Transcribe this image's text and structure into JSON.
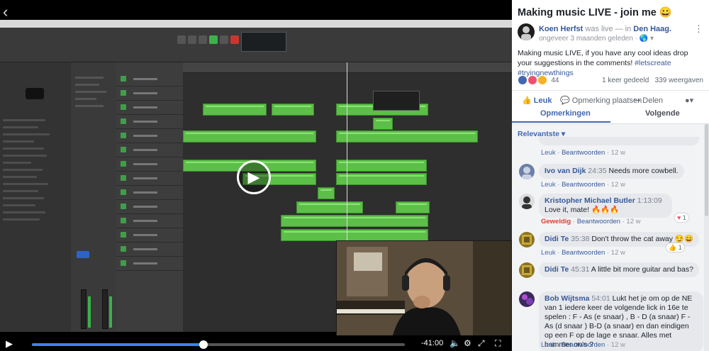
{
  "player": {
    "back_glyph": "‹",
    "time_remaining": "-41:00",
    "progress": 0.46,
    "play_glyph": "▶",
    "controls": [
      "play-icon",
      "volume-icon",
      "settings-icon",
      "fullscreen-icon",
      "expand-icon"
    ]
  },
  "post": {
    "title": "Making music LIVE - join me 😀",
    "author": "Koen Herfst",
    "was_live": "was live —",
    "in_word": "in",
    "location": "Den Haag.",
    "time": "ongeveer 3 maanden geleden · 🌎 ▾",
    "description": "Making music LIVE, if you have any cool ideas drop your suggestions in the comments!",
    "hashtags": "#letscreate #tryingnewthings",
    "reaction_count": "44",
    "shares": "1 keer gedeeld",
    "views": "339 weergaven",
    "actions": {
      "like": "Leuk",
      "comment": "Opmerking plaatsen",
      "share": "Delen"
    },
    "tabs": {
      "comments": "Opmerkingen",
      "following": "Volgende"
    },
    "sort_label": "Relevantste ▾"
  },
  "comments": [
    {
      "meta_like": "Leuk",
      "reply": "Beantwoorden",
      "age": "12 w"
    },
    {
      "name": "Ivo van Dijk",
      "ts": "24:35",
      "text": "Needs more cowbell.",
      "meta_like": "Leuk",
      "reply": "Beantwoorden",
      "age": "12 w"
    },
    {
      "name": "Kristopher Michael Butler",
      "ts": "1:13:09",
      "text": "Love it, mate! 🔥🔥🔥",
      "meta_like": "Geweldig",
      "reply": "Beantwoorden",
      "age": "12 w",
      "react_count": "1"
    },
    {
      "name": "Didi Te",
      "ts": "35:38",
      "text": "Don't throw the cat away 😏😄",
      "meta_like": "Leuk",
      "reply": "Beantwoorden",
      "age": "12 w",
      "react_count": "1"
    },
    {
      "name": "Didi Te",
      "ts": "45:31",
      "text": "A little bit more guitar and bas?"
    },
    {
      "name": "Bob Wijtsma",
      "ts": "54:01",
      "text": "Lukt het je om op de NE van 1 iedere keer de volgende lick in 16e te spelen : F - As (e snaar) , B - D (a snaar) F - As (d snaar ) B-D (a snaar) en dan eindigen op een F op de lage e snaar. Alles met hammer on's ?",
      "meta_like": "Leuk",
      "reply": "Beantwoorden",
      "age": "12 w"
    }
  ],
  "colors": {
    "facebook_blue": "#4267b2",
    "link_blue": "#365899",
    "region_green": "#5cbf47",
    "progress_blue": "#3b82f6"
  }
}
